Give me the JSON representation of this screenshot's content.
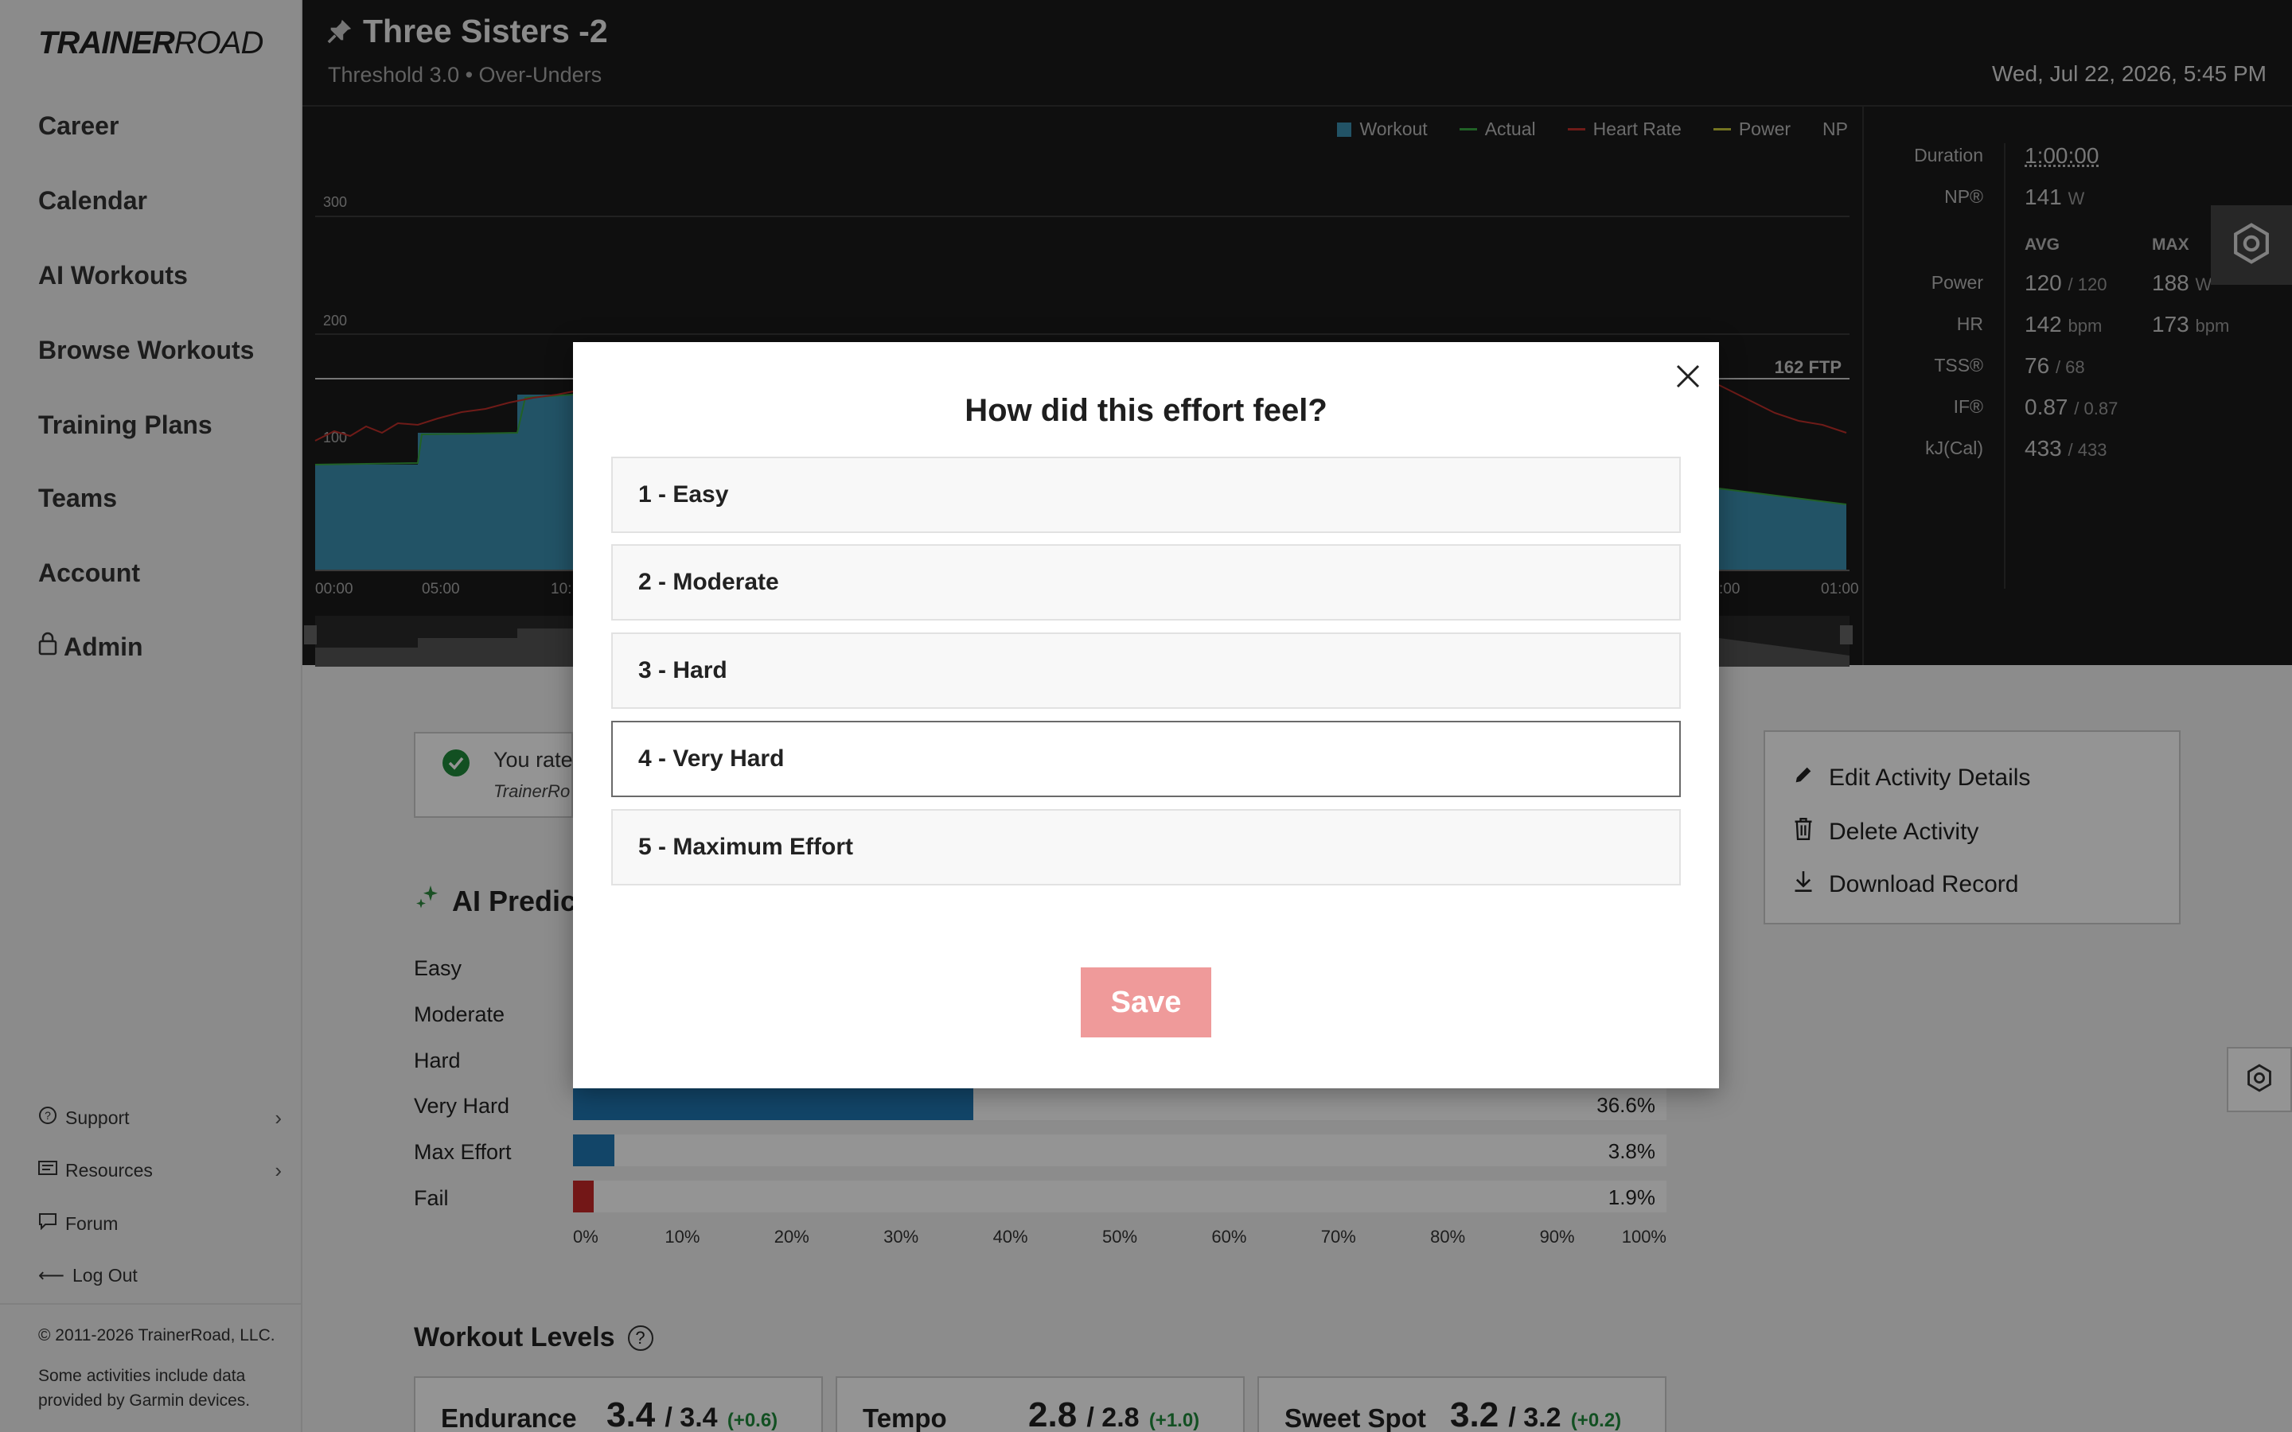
{
  "app": {
    "logo_bold": "TRAINER",
    "logo_thin": "ROAD"
  },
  "sidebar": {
    "nav": [
      {
        "label": "Career"
      },
      {
        "label": "Calendar"
      },
      {
        "label": "AI Workouts"
      },
      {
        "label": "Browse Workouts"
      },
      {
        "label": "Training Plans"
      },
      {
        "label": "Teams"
      },
      {
        "label": "Account"
      },
      {
        "label": "Admin",
        "icon": "lock-icon"
      }
    ],
    "links": [
      {
        "label": "Support",
        "icon": "help-circle-icon"
      },
      {
        "label": "Resources",
        "icon": "document-icon"
      },
      {
        "label": "Forum",
        "icon": "chat-icon"
      },
      {
        "label": "Log Out",
        "icon": "arrow-left-icon"
      }
    ],
    "copyright": "© 2011-2026 TrainerRoad, LLC.",
    "garmin_note": "Some activities include data provided by Garmin devices."
  },
  "header": {
    "title": "Three Sisters -2",
    "subtitle": "Threshold 3.0 • Over-Unders",
    "date": "Wed, Jul 22, 2026, 5:45 PM"
  },
  "chart": {
    "legend": [
      "Workout",
      "Actual",
      "Heart Rate",
      "Power",
      "NP"
    ],
    "y_ticks": [
      "300",
      "200",
      "100"
    ],
    "x_ticks": [
      "00:00",
      "05:00",
      "10:",
      ":00",
      "01:00"
    ],
    "ftp_label": "162 FTP",
    "colors": {
      "workout": "#3b8fb0",
      "actual": "#3aa843",
      "heart_rate": "#c0302a",
      "power": "#c8c83a"
    }
  },
  "stats": {
    "duration_label": "Duration",
    "duration": "1:00:00",
    "np_label": "NP®",
    "np": "141",
    "np_unit": "W",
    "avg_head": "AVG",
    "max_head": "MAX",
    "rows": [
      {
        "label": "Power",
        "avg": "120",
        "avg_sub": "/ 120",
        "max": "188",
        "max_unit": "W"
      },
      {
        "label": "HR",
        "avg": "142",
        "avg_sub": "bpm",
        "max": "173",
        "max_unit": "bpm"
      },
      {
        "label": "TSS®",
        "avg": "76",
        "avg_sub": "/ 68"
      },
      {
        "label": "IF®",
        "avg": "0.87",
        "avg_sub": "/ 0.87"
      },
      {
        "label": "kJ(Cal)",
        "avg": "433",
        "avg_sub": "/ 433"
      }
    ]
  },
  "rated": {
    "text": "You rate",
    "sub": "TrainerRo"
  },
  "ai_prediction": {
    "title": "AI Predic",
    "labels": [
      "Easy",
      "Moderate",
      "Hard",
      "Very Hard",
      "Max Effort",
      "Fail"
    ],
    "bars": [
      {
        "label": "Very Hard",
        "pct": 36.6,
        "pct_text": "36.6%",
        "color": "#1f78b4"
      },
      {
        "label": "Max Effort",
        "pct": 3.8,
        "pct_text": "3.8%",
        "color": "#1f78b4"
      },
      {
        "label": "Fail",
        "pct": 1.9,
        "pct_text": "1.9%",
        "color": "#c62828"
      }
    ],
    "ticks": [
      "0%",
      "10%",
      "20%",
      "30%",
      "40%",
      "50%",
      "60%",
      "70%",
      "80%",
      "90%",
      "100%"
    ]
  },
  "workout_levels": {
    "title": "Workout Levels",
    "help": "?",
    "cards": [
      {
        "name": "Endurance",
        "value": "3.4",
        "of": "/ 3.4",
        "delta": "(+0.6)"
      },
      {
        "name": "Tempo",
        "value": "2.8",
        "of": "/ 2.8",
        "delta": "(+1.0)"
      },
      {
        "name": "Sweet Spot",
        "value": "3.2",
        "of": "/ 3.2",
        "delta": "(+0.2)"
      }
    ]
  },
  "actions": [
    {
      "label": "Edit Activity Details",
      "icon": "pencil-icon"
    },
    {
      "label": "Delete Activity",
      "icon": "trash-icon"
    },
    {
      "label": "Download Record",
      "icon": "download-icon"
    }
  ],
  "modal": {
    "title": "How did this effort feel?",
    "options": [
      {
        "label": "1 - Easy",
        "selected": false
      },
      {
        "label": "2 - Moderate",
        "selected": false
      },
      {
        "label": "3 - Hard",
        "selected": false
      },
      {
        "label": "4 - Very Hard",
        "selected": true
      },
      {
        "label": "5 - Maximum Effort",
        "selected": false
      }
    ],
    "save_label": "Save"
  }
}
